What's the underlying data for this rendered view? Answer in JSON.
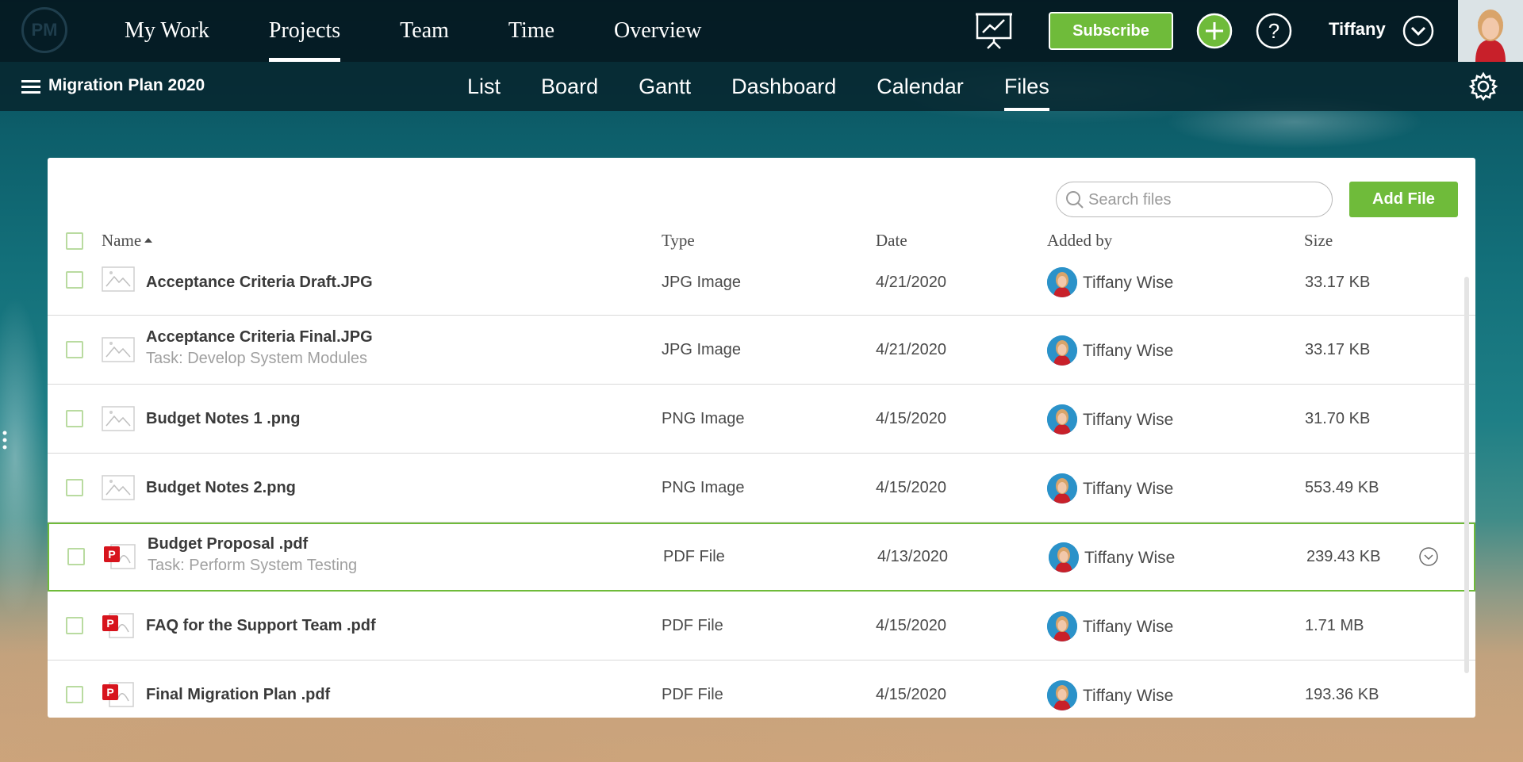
{
  "app": {
    "logo_text": "PM",
    "user_name": "Tiffany",
    "subscribe_label": "Subscribe",
    "colors": {
      "accent_green": "#6fbb3a",
      "topbar": "#04161e"
    }
  },
  "main_nav": [
    {
      "label": "My Work",
      "active": false
    },
    {
      "label": "Projects",
      "active": true
    },
    {
      "label": "Team",
      "active": false
    },
    {
      "label": "Time",
      "active": false
    },
    {
      "label": "Overview",
      "active": false
    }
  ],
  "project": {
    "title": "Migration Plan 2020"
  },
  "view_tabs": [
    {
      "label": "List",
      "active": false
    },
    {
      "label": "Board",
      "active": false
    },
    {
      "label": "Gantt",
      "active": false
    },
    {
      "label": "Dashboard",
      "active": false
    },
    {
      "label": "Calendar",
      "active": false
    },
    {
      "label": "Files",
      "active": true
    }
  ],
  "files": {
    "search_placeholder": "Search files",
    "add_file_label": "Add File",
    "columns": {
      "name": "Name",
      "type": "Type",
      "date": "Date",
      "added_by": "Added by",
      "size": "Size"
    },
    "rows": [
      {
        "name": "Acceptance Criteria Draft.JPG",
        "task": "",
        "type": "JPG Image",
        "date": "4/21/2020",
        "added_by": "Tiffany Wise",
        "size": "33.17 KB",
        "icon": "image-file-icon"
      },
      {
        "name": "Acceptance Criteria Final.JPG",
        "task": "Task: Develop System Modules",
        "type": "JPG Image",
        "date": "4/21/2020",
        "added_by": "Tiffany Wise",
        "size": "33.17 KB",
        "icon": "image-file-icon"
      },
      {
        "name": "Budget Notes 1 .png",
        "task": "",
        "type": "PNG Image",
        "date": "4/15/2020",
        "added_by": "Tiffany Wise",
        "size": "31.70 KB",
        "icon": "image-file-icon"
      },
      {
        "name": "Budget Notes 2.png",
        "task": "",
        "type": "PNG Image",
        "date": "4/15/2020",
        "added_by": "Tiffany Wise",
        "size": "553.49 KB",
        "icon": "image-file-icon"
      },
      {
        "name": "Budget Proposal .pdf",
        "task": "Task: Perform System Testing",
        "type": "PDF File",
        "date": "4/13/2020",
        "added_by": "Tiffany Wise",
        "size": "239.43 KB",
        "icon": "pdf-file-icon"
      },
      {
        "name": "FAQ for the Support Team .pdf",
        "task": "",
        "type": "PDF File",
        "date": "4/15/2020",
        "added_by": "Tiffany Wise",
        "size": "1.71 MB",
        "icon": "pdf-file-icon"
      },
      {
        "name": "Final Migration Plan .pdf",
        "task": "",
        "type": "PDF File",
        "date": "4/15/2020",
        "added_by": "Tiffany Wise",
        "size": "193.36 KB",
        "icon": "pdf-file-icon"
      }
    ]
  }
}
